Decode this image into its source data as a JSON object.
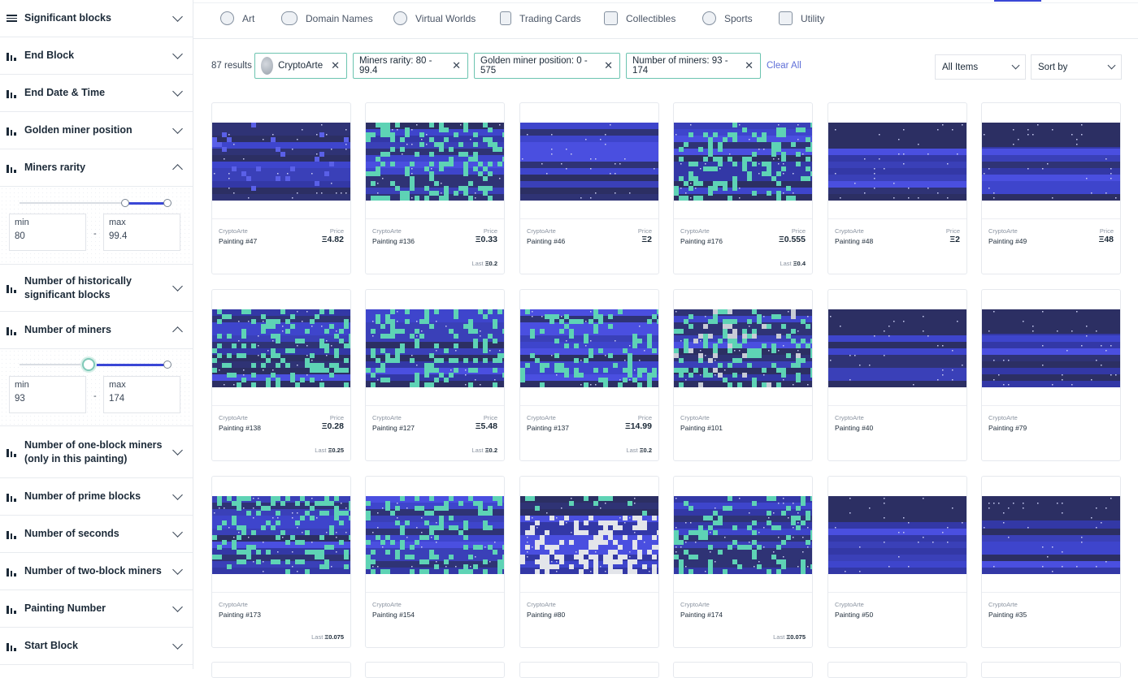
{
  "sidebar": {
    "filters": [
      {
        "label": "Significant blocks"
      },
      {
        "label": "End Block"
      },
      {
        "label": "End Date & Time"
      },
      {
        "label": "Golden miner position"
      },
      {
        "label": "Miners rarity"
      },
      {
        "label": "Number of historically significant blocks"
      },
      {
        "label": "Number of miners"
      },
      {
        "label": "Number of one-block miners (only in this painting)"
      },
      {
        "label": "Number of prime blocks"
      },
      {
        "label": "Number of seconds"
      },
      {
        "label": "Number of two-block miners"
      },
      {
        "label": "Painting Number"
      },
      {
        "label": "Start Block"
      }
    ],
    "miners_rarity": {
      "min_label": "min",
      "min_value": "80",
      "max_label": "max",
      "max_value": "99.4",
      "dash": "-"
    },
    "number_of_miners": {
      "min_label": "min",
      "min_value": "93",
      "max_label": "max",
      "max_value": "174",
      "dash": "-"
    }
  },
  "categories": [
    {
      "label": "Art",
      "icon": "palette-icon"
    },
    {
      "label": "Domain Names",
      "icon": "domain-icon"
    },
    {
      "label": "Virtual Worlds",
      "icon": "globe-icon"
    },
    {
      "label": "Trading Cards",
      "icon": "cards-icon"
    },
    {
      "label": "Collectibles",
      "icon": "collectibles-icon"
    },
    {
      "label": "Sports",
      "icon": "ball-icon"
    },
    {
      "label": "Utility",
      "icon": "utility-icon"
    }
  ],
  "results_count": "87 results",
  "chips": [
    {
      "label": "CryptoArte",
      "close": "✕"
    },
    {
      "label": "Miners rarity: 80 - 99.4",
      "close": "✕"
    },
    {
      "label": "Golden miner position: 0 - 575",
      "close": "✕"
    },
    {
      "label": "Number of miners: 93 - 174",
      "close": "✕"
    }
  ],
  "clear_all": "Clear All",
  "items_select": "All Items",
  "sort_select": "Sort by",
  "cards": [
    {
      "collection": "CryptoArte",
      "name": "Painting #47",
      "price_label": "Price",
      "price": "Ξ4.82",
      "last": "",
      "style": "stripes"
    },
    {
      "collection": "CryptoArte",
      "name": "Painting #136",
      "price_label": "Price",
      "price": "Ξ0.33",
      "last_label": "Last",
      "last": "Ξ0.2",
      "style": "teal"
    },
    {
      "collection": "CryptoArte",
      "name": "Painting #46",
      "price_label": "Price",
      "price": "Ξ2",
      "last": "",
      "style": "blue"
    },
    {
      "collection": "CryptoArte",
      "name": "Painting #176",
      "price_label": "Price",
      "price": "Ξ0.555",
      "last_label": "Last",
      "last": "Ξ0.4",
      "style": "teal"
    },
    {
      "collection": "CryptoArte",
      "name": "Painting #48",
      "price_label": "Price",
      "price": "Ξ2",
      "last": "",
      "style": "dark"
    },
    {
      "collection": "CryptoArte",
      "name": "Painting #49",
      "price_label": "Price",
      "price": "Ξ48",
      "last": "",
      "style": "dark"
    },
    {
      "collection": "CryptoArte",
      "name": "Painting #138",
      "price_label": "Price",
      "price": "Ξ0.28",
      "last_label": "Last",
      "last": "Ξ0.25",
      "style": "teal"
    },
    {
      "collection": "CryptoArte",
      "name": "Painting #127",
      "price_label": "Price",
      "price": "Ξ5.48",
      "last_label": "Last",
      "last": "Ξ0.2",
      "style": "teal"
    },
    {
      "collection": "CryptoArte",
      "name": "Painting #137",
      "price_label": "Price",
      "price": "Ξ14.99",
      "last_label": "Last",
      "last": "Ξ0.2",
      "style": "teal"
    },
    {
      "collection": "CryptoArte",
      "name": "Painting #101",
      "price_label": "",
      "price": "",
      "last": "",
      "style": "mixed"
    },
    {
      "collection": "CryptoArte",
      "name": "Painting #40",
      "price_label": "",
      "price": "",
      "last": "",
      "style": "dark"
    },
    {
      "collection": "CryptoArte",
      "name": "Painting #79",
      "price_label": "",
      "price": "",
      "last": "",
      "style": "dark"
    },
    {
      "collection": "CryptoArte",
      "name": "Painting #173",
      "price_label": "",
      "price": "",
      "last_label": "Last",
      "last": "Ξ0.075",
      "style": "teal"
    },
    {
      "collection": "CryptoArte",
      "name": "Painting #154",
      "price_label": "",
      "price": "",
      "last": "",
      "style": "teal"
    },
    {
      "collection": "CryptoArte",
      "name": "Painting #80",
      "price_label": "",
      "price": "",
      "last": "",
      "style": "white"
    },
    {
      "collection": "CryptoArte",
      "name": "Painting #174",
      "price_label": "",
      "price": "",
      "last_label": "Last",
      "last": "Ξ0.075",
      "style": "teal"
    },
    {
      "collection": "CryptoArte",
      "name": "Painting #50",
      "price_label": "",
      "price": "",
      "last": "",
      "style": "dark"
    },
    {
      "collection": "CryptoArte",
      "name": "Painting #35",
      "price_label": "",
      "price": "",
      "last": "",
      "style": "dark"
    }
  ],
  "colors": {
    "accent": "#3a47d6",
    "teal": "#5ed3b5",
    "chip_border": "#6cc4b0",
    "link": "#5f6fd8"
  }
}
